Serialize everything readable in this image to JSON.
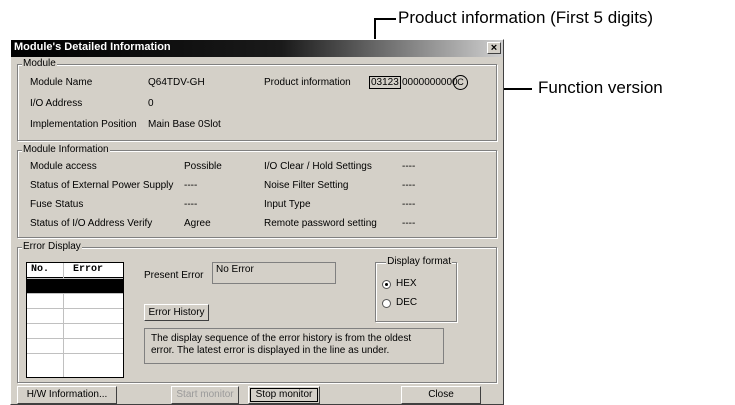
{
  "annotations": {
    "product_info_callout": "Product information (First 5 digits)",
    "function_version_callout": "Function version"
  },
  "window": {
    "title": "Module's Detailed Information",
    "close_glyph": "×"
  },
  "module": {
    "legend": "Module",
    "name_label": "Module Name",
    "name_value": "Q64TDV-GH",
    "product_info_label": "Product information",
    "product_info_first5": "03123",
    "product_info_rest": "0000000000",
    "function_version": "C",
    "io_address_label": "I/O Address",
    "io_address_value": "0",
    "impl_position_label": "Implementation Position",
    "impl_position_value": "Main Base  0Slot"
  },
  "module_info": {
    "legend": "Module Information",
    "rows": [
      {
        "label": "Module access",
        "value": "Possible",
        "label2": "I/O Clear / Hold Settings",
        "value2": "----"
      },
      {
        "label": "Status of External Power Supply",
        "value": "----",
        "label2": "Noise Filter Setting",
        "value2": "----"
      },
      {
        "label": "Fuse Status",
        "value": "----",
        "label2": "Input Type",
        "value2": "----"
      },
      {
        "label": "Status of I/O Address Verify",
        "value": "Agree",
        "label2": "Remote password setting",
        "value2": "----"
      }
    ]
  },
  "error_display": {
    "legend": "Error Display",
    "col_no": "No.",
    "col_error": "Error",
    "present_error_label": "Present Error",
    "present_error_value": "No Error",
    "error_history_button": "Error History",
    "note": "The display sequence of the error history is from the oldest error. The latest error is displayed in the line as under.",
    "display_format": {
      "legend": "Display format",
      "hex": "HEX",
      "dec": "DEC",
      "selected": "HEX"
    }
  },
  "buttons": {
    "hw_info": "H/W Information...",
    "start_monitor": "Start monitor",
    "stop_monitor": "Stop monitor",
    "close": "Close"
  }
}
